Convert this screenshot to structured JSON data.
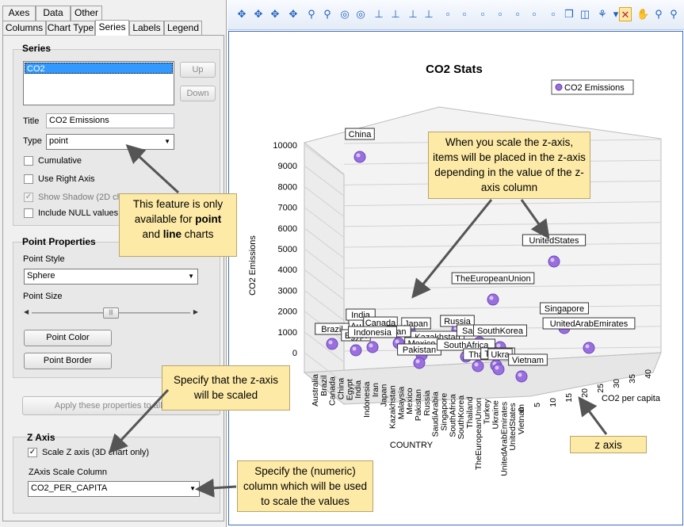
{
  "tabs_row1": [
    "Axes",
    "Data",
    "Other"
  ],
  "tabs_row2": [
    "Columns",
    "Chart Type",
    "Series",
    "Labels",
    "Legend"
  ],
  "series_group": {
    "title": "Series",
    "list_item": "CO2",
    "up_label": "Up",
    "down_label": "Down",
    "title_label": "Title",
    "title_value": "CO2 Emissions",
    "type_label": "Type",
    "type_value": "point",
    "cumulative_label": "Cumulative",
    "use_right_axis_label": "Use Right Axis",
    "show_shadow_label": "Show Shadow (2D ch",
    "include_null_label": "Include NULL values"
  },
  "point_group": {
    "title": "Point Properties",
    "style_label": "Point Style",
    "style_value": "Sphere",
    "size_label": "Point Size",
    "color_button": "Point Color",
    "border_button": "Point Border"
  },
  "apply_button": "Apply these properties to all series",
  "zaxis_group": {
    "title": "Z Axis",
    "scale_checkbox_label": "Scale Z axis (3D chart only)",
    "scale_checked": true,
    "column_label": "ZAxis Scale Column",
    "column_value": "CO2_PER_CAPITA"
  },
  "callouts": {
    "point_line_1": "This feature is only",
    "point_line_2a": "available for ",
    "point_line_2b": "point",
    "point_line_3a": "and ",
    "point_line_3b": "line",
    "point_line_3c": " charts",
    "zscale": "Specify that the z-axis will be scaled",
    "numeric_col": "Specify the (numeric) column which will be used to scale the values",
    "zaxis_items": "When you scale the z-axis, items will be placed in the z-axis depending in the value of the z-axis column",
    "zaxis_label": "z axis"
  },
  "toolbar_icons": [
    "rotate-x-icon",
    "rotate-y-icon",
    "rotate-z-icon",
    "rotate-xy-icon",
    "zoom-in-icon",
    "zoom-out-icon",
    "perspective-icon",
    "perspective-reset-icon",
    "axis-left-icon",
    "axis-right-icon",
    "axis-up-icon",
    "axis-down-icon",
    "box-1-icon",
    "box-2-icon",
    "box-3-icon",
    "box-4-icon",
    "box-5-icon",
    "box-6-icon",
    "box-7-icon",
    "cube-icon",
    "cube-frame-icon",
    "chart-type-icon",
    "dropdown-icon",
    "no-rotate-icon",
    "hand-icon",
    "zoom-fit-icon",
    "zoom-window-icon"
  ],
  "chart_data": {
    "type": "scatter",
    "title": "CO2 Stats",
    "legend": "CO2 Emissions",
    "legend_position": "top-right",
    "ylabel": "CO2 Emissions",
    "xlabel": "COUNTRY",
    "zlabel": "CO2 per capita",
    "y_ticks": [
      "0",
      "1000",
      "2000",
      "3000",
      "4000",
      "5000",
      "6000",
      "7000",
      "8000",
      "9000",
      "10000"
    ],
    "z_ticks": [
      "0",
      "5",
      "10",
      "15",
      "20",
      "25",
      "30",
      "35",
      "40"
    ],
    "categories": [
      "Australia",
      "Brazil",
      "Canada",
      "China",
      "Egypt",
      "India",
      "Indonesia",
      "Iran",
      "Japan",
      "Kazakhstan",
      "Malaysia",
      "Mexico",
      "Pakistan",
      "Russia",
      "SaudiArabia",
      "Singapore",
      "SouthAfrica",
      "SouthKorea",
      "Thailand",
      "TheEuropeanUnion",
      "Turkey",
      "Ukraine",
      "UnitedArabEmirates",
      "UnitedStates",
      "Vietnam"
    ],
    "points": [
      {
        "label": "China",
        "y": 10000
      },
      {
        "label": "UnitedStates",
        "y": 5400
      },
      {
        "label": "TheEuropeanUnion",
        "y": 3600
      },
      {
        "label": "India",
        "y": 2300
      },
      {
        "label": "Au",
        "y": 400
      },
      {
        "label": "Canada",
        "y": 550
      },
      {
        "label": "Japan",
        "y": 1250
      },
      {
        "label": "Russia",
        "y": 1700
      },
      {
        "label": "Brazil",
        "y": 480
      },
      {
        "label": "Iran",
        "y": 600
      },
      {
        "label": "Egypt",
        "y": 230
      },
      {
        "label": "Indonesia",
        "y": 500
      },
      {
        "label": "Kazakhstan",
        "y": 280
      },
      {
        "label": "Mexico",
        "y": 450
      },
      {
        "label": "Pakistan",
        "y": 180
      },
      {
        "label": "SaudiArabia",
        "y": 600
      },
      {
        "label": "SouthKorea",
        "y": 650
      },
      {
        "label": "SouthAfrica",
        "y": 450
      },
      {
        "label": "Thail",
        "y": 280
      },
      {
        "label": "Turkey",
        "y": 340
      },
      {
        "label": "Ukra",
        "y": 290
      },
      {
        "label": "Vietnam",
        "y": 200
      },
      {
        "label": "Singapore",
        "y": 200
      },
      {
        "label": "UnitedArabEmirates",
        "y": 200
      }
    ]
  }
}
